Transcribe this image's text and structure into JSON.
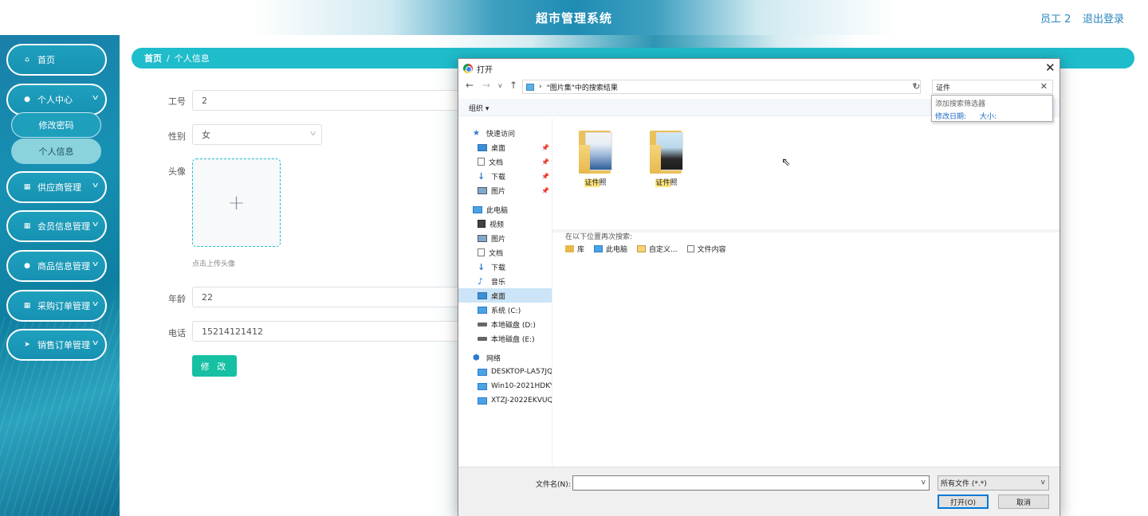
{
  "header": {
    "title": "超市管理系统",
    "user": "员工 2",
    "logout": "退出登录"
  },
  "sidebar": {
    "items": [
      {
        "label": "首页",
        "icon": "home-icon"
      },
      {
        "label": "个人中心",
        "icon": "user-icon"
      },
      {
        "label": "供应商管理",
        "icon": "grid-icon"
      },
      {
        "label": "会员信息管理",
        "icon": "grid-icon"
      },
      {
        "label": "商品信息管理",
        "icon": "user-icon"
      },
      {
        "label": "采购订单管理",
        "icon": "grid-icon"
      },
      {
        "label": "销售订单管理",
        "icon": "send-icon"
      }
    ],
    "subitems": [
      {
        "label": "修改密码"
      },
      {
        "label": "个人信息"
      }
    ]
  },
  "breadcrumb": {
    "home": "首页",
    "separator": "/",
    "current": "个人信息"
  },
  "form": {
    "employee_no_label": "工号",
    "employee_no": "2",
    "gender_label": "性别",
    "gender": "女",
    "avatar_label": "头像",
    "upload_tip": "点击上传头像",
    "age_label": "年龄",
    "age": "22",
    "phone_label": "电话",
    "phone": "15214121412",
    "submit": "修 改"
  },
  "dialog": {
    "title": "打开",
    "address": "\"图片集\"中的搜索结果",
    "search_value": "证件",
    "search_popup": {
      "header": "添加搜索筛选器",
      "filters": [
        "修改日期:",
        "大小:"
      ]
    },
    "organize": "组织 ▾",
    "nav": {
      "quick_access": "快速访问",
      "quick_items": [
        "桌面",
        "文档",
        "下载",
        "图片"
      ],
      "this_pc": "此电脑",
      "pc_items": [
        "视频",
        "图片",
        "文档",
        "下载",
        "音乐",
        "桌面",
        "系统 (C:)",
        "本地磁盘 (D:)",
        "本地磁盘 (E:)"
      ],
      "network": "网络",
      "network_items": [
        "DESKTOP-LA57JQ",
        "Win10-2021HDKY",
        "XTZJ-2022EKVUQ"
      ]
    },
    "files": [
      {
        "name_hl": "证件",
        "name_rest": "照"
      },
      {
        "name_hl": "证件",
        "name_rest": "照"
      }
    ],
    "search_again_label": "在以下位置再次搜索:",
    "search_again_links": [
      "库",
      "此电脑",
      "自定义...",
      "文件内容"
    ],
    "filename_label": "文件名(N):",
    "filetype": "所有文件 (*.*)",
    "open_button": "打开(O)",
    "cancel_button": "取消"
  }
}
